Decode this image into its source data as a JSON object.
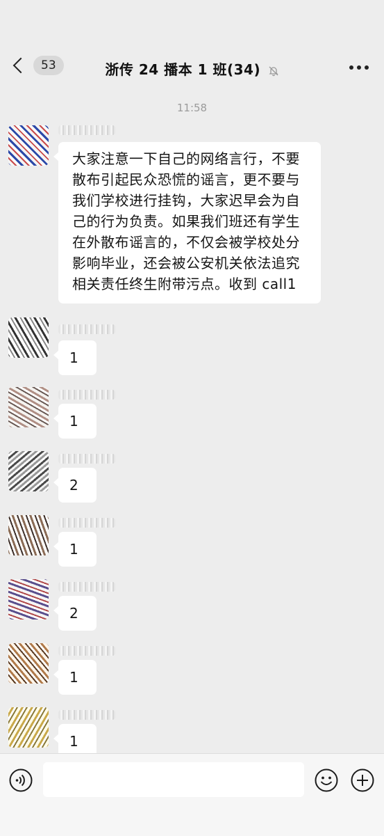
{
  "header": {
    "unread_count": "53",
    "title": "浙传 24 播本 1 班(34)"
  },
  "timestamp": "11:58",
  "messages": [
    {
      "text": "大家注意一下自己的网络言行，不要散布引起民众恐慌的谣言，更不要与我们学校进行挂钩，大家迟早会为自己的行为负责。如果我们班还有学生在外散布谣言的，不仅会被学校处分影响毕业，还会被公安机关依法追究相关责任终生附带污点。收到 call1"
    },
    {
      "text": "1"
    },
    {
      "text": "1"
    },
    {
      "text": "2"
    },
    {
      "text": "1"
    },
    {
      "text": "2"
    },
    {
      "text": "1"
    },
    {
      "text": "1"
    }
  ],
  "input": {
    "placeholder": ""
  },
  "icons": {
    "back": "chevron-left-icon",
    "mute": "bell-off-icon",
    "more": "more-icon",
    "voice": "voice-icon",
    "emoji": "emoji-icon",
    "plus": "plus-icon"
  },
  "colors": {
    "background": "#ededed",
    "bubble": "#ffffff",
    "timestamp": "#9b9b9b",
    "input_bar": "#f6f6f6"
  }
}
